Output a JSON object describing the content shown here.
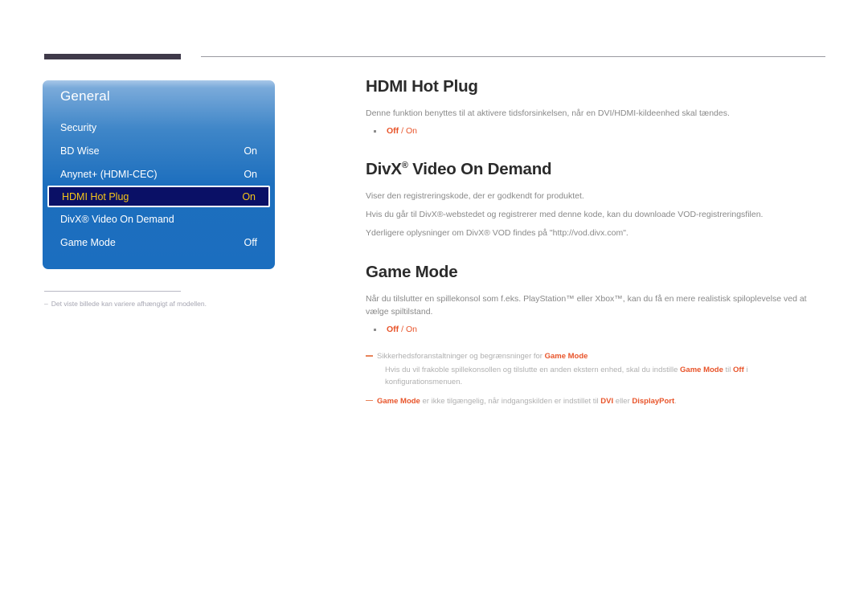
{
  "osd": {
    "title": "General",
    "rows": [
      {
        "label": "Security",
        "value": "",
        "selected": false
      },
      {
        "label": "BD Wise",
        "value": "On",
        "selected": false
      },
      {
        "label": "Anynet+ (HDMI-CEC)",
        "value": "On",
        "selected": false
      },
      {
        "label": "HDMI Hot Plug",
        "value": "On",
        "selected": true
      },
      {
        "label": "DivX® Video On Demand",
        "value": "",
        "selected": false
      },
      {
        "label": "Game Mode",
        "value": "Off",
        "selected": false
      }
    ],
    "footnote": {
      "dash": "–",
      "text": "Det viste billede kan variere afhængigt af modellen."
    },
    "colors": {
      "panel_top": "#7aaada",
      "panel_bottom": "#1b6ebf",
      "selected_bg": "#0a1066",
      "selected_text": "#f5c518"
    }
  },
  "content": {
    "sections": [
      {
        "id": "hdmi-hot-plug",
        "title": "HDMI Hot Plug",
        "title_sup": "",
        "paragraphs": [
          "Denne funktion benyttes til at aktivere tidsforsinkelsen, når en DVI/HDMI-kildeenhed skal tændes."
        ],
        "bullet": {
          "bold": "Off",
          "sep": " / ",
          "rest": "On"
        }
      },
      {
        "id": "divx-video-on-demand",
        "title": "DivX",
        "title_sup": "®",
        "title_rest": " Video On Demand",
        "paragraphs": [
          "Viser den registreringskode, der er godkendt for produktet.",
          "Hvis du går til DivX®-webstedet og registrerer med denne kode, kan du downloade VOD-registreringsfilen.",
          "Yderligere oplysninger om DivX® VOD findes på \"http://vod.divx.com\"."
        ]
      },
      {
        "id": "game-mode",
        "title": "Game Mode",
        "title_sup": "",
        "paragraphs": [
          "Når du tilslutter en spillekonsol som f.eks. PlayStation™ eller Xbox™, kan du få en mere realistisk spiloplevelse ved at vælge spiltilstand."
        ],
        "bullet": {
          "bold": "Off",
          "sep": " / ",
          "rest": "On"
        }
      }
    ],
    "notes": {
      "note1_pre": "Sikkerhedsforanstaltninger og begrænsninger for ",
      "note1_hl": "Game Mode",
      "note1_sub_a": "Hvis du vil frakoble spillekonsollen og tilslutte en anden ekstern enhed, skal du indstille ",
      "note1_sub_hl1": "Game Mode",
      "note1_sub_b": " til ",
      "note1_sub_hl2": "Off",
      "note1_sub_c": " i konfigurationsmenuen.",
      "note2_hl1": "Game Mode",
      "note2_a": " er ikke tilgængelig, når indgangskilden er indstillet til ",
      "note2_hl2": "DVI",
      "note2_b": " eller ",
      "note2_hl3": "DisplayPort",
      "note2_c": "."
    }
  },
  "theme": {
    "accent": "#e8542a",
    "body_text": "#898989",
    "heading": "#2b2b2b",
    "rule_dark": "#3f3a4a",
    "rule_light": "#9a9aa0"
  }
}
